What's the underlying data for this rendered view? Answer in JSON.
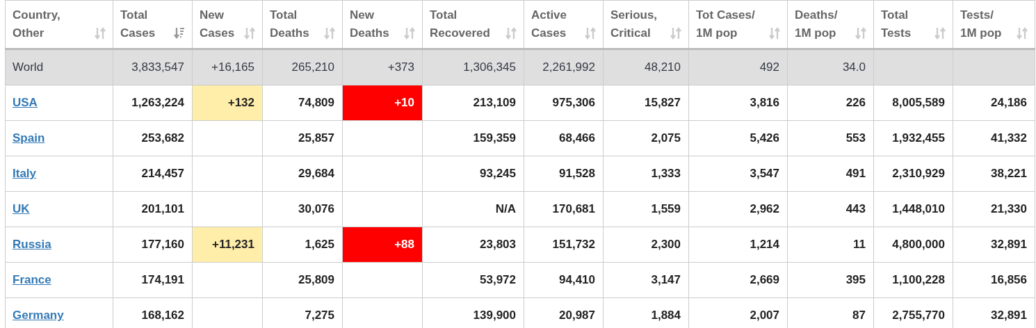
{
  "table": {
    "columns": [
      {
        "label": "Country,\nOther",
        "sorted": false
      },
      {
        "label": "Total\nCases",
        "sorted": true
      },
      {
        "label": "New\nCases",
        "sorted": false
      },
      {
        "label": "Total\nDeaths",
        "sorted": false
      },
      {
        "label": "New\nDeaths",
        "sorted": false
      },
      {
        "label": "Total\nRecovered",
        "sorted": false
      },
      {
        "label": "Active\nCases",
        "sorted": false
      },
      {
        "label": "Serious,\nCritical",
        "sorted": false
      },
      {
        "label": "Tot Cases/\n1M pop",
        "sorted": false
      },
      {
        "label": "Deaths/\n1M pop",
        "sorted": false
      },
      {
        "label": "Total\nTests",
        "sorted": false
      },
      {
        "label": "Tests/\n1M pop",
        "sorted": false
      }
    ],
    "rows": [
      {
        "kind": "total",
        "cells": [
          "World",
          "3,833,547",
          "+16,165",
          "265,210",
          "+373",
          "1,306,345",
          "2,261,992",
          "48,210",
          "492",
          "34.0",
          "",
          ""
        ],
        "new_cases_highlight": false,
        "new_deaths_highlight": false
      },
      {
        "kind": "country",
        "cells": [
          "USA",
          "1,263,224",
          "+132",
          "74,809",
          "+10",
          "213,109",
          "975,306",
          "15,827",
          "3,816",
          "226",
          "8,005,589",
          "24,186"
        ],
        "new_cases_highlight": true,
        "new_deaths_highlight": true
      },
      {
        "kind": "country",
        "cells": [
          "Spain",
          "253,682",
          "",
          "25,857",
          "",
          "159,359",
          "68,466",
          "2,075",
          "5,426",
          "553",
          "1,932,455",
          "41,332"
        ],
        "new_cases_highlight": false,
        "new_deaths_highlight": false
      },
      {
        "kind": "country",
        "cells": [
          "Italy",
          "214,457",
          "",
          "29,684",
          "",
          "93,245",
          "91,528",
          "1,333",
          "3,547",
          "491",
          "2,310,929",
          "38,221"
        ],
        "new_cases_highlight": false,
        "new_deaths_highlight": false
      },
      {
        "kind": "country",
        "cells": [
          "UK",
          "201,101",
          "",
          "30,076",
          "",
          "N/A",
          "170,681",
          "1,559",
          "2,962",
          "443",
          "1,448,010",
          "21,330"
        ],
        "new_cases_highlight": false,
        "new_deaths_highlight": false
      },
      {
        "kind": "country",
        "cells": [
          "Russia",
          "177,160",
          "+11,231",
          "1,625",
          "+88",
          "23,803",
          "151,732",
          "2,300",
          "1,214",
          "11",
          "4,800,000",
          "32,891"
        ],
        "new_cases_highlight": true,
        "new_deaths_highlight": true
      },
      {
        "kind": "country",
        "cells": [
          "France",
          "174,191",
          "",
          "25,809",
          "",
          "53,972",
          "94,410",
          "3,147",
          "2,669",
          "395",
          "1,100,228",
          "16,856"
        ],
        "new_cases_highlight": false,
        "new_deaths_highlight": false
      },
      {
        "kind": "country",
        "cells": [
          "Germany",
          "168,162",
          "",
          "7,275",
          "",
          "139,900",
          "20,987",
          "1,884",
          "2,007",
          "87",
          "2,755,770",
          "32,891"
        ],
        "new_cases_highlight": false,
        "new_deaths_highlight": false
      }
    ]
  }
}
